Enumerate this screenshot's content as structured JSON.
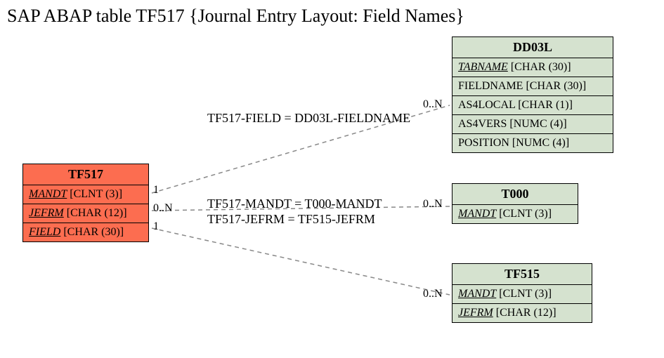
{
  "title": "SAP ABAP table TF517 {Journal Entry Layout:  Field Names}",
  "entities": {
    "tf517": {
      "name": "TF517",
      "rows": [
        {
          "field": "MANDT",
          "type": "[CLNT (3)]",
          "key": true
        },
        {
          "field": "JEFRM",
          "type": "[CHAR (12)]",
          "key": true
        },
        {
          "field": "FIELD",
          "type": "[CHAR (30)]",
          "key": true
        }
      ]
    },
    "dd03l": {
      "name": "DD03L",
      "rows": [
        {
          "field": "TABNAME",
          "type": "[CHAR (30)]",
          "key": true
        },
        {
          "field": "FIELDNAME",
          "type": "[CHAR (30)]",
          "key": false
        },
        {
          "field": "AS4LOCAL",
          "type": "[CHAR (1)]",
          "key": false
        },
        {
          "field": "AS4VERS",
          "type": "[NUMC (4)]",
          "key": false
        },
        {
          "field": "POSITION",
          "type": "[NUMC (4)]",
          "key": false
        }
      ]
    },
    "t000": {
      "name": "T000",
      "rows": [
        {
          "field": "MANDT",
          "type": "[CLNT (3)]",
          "key": true
        }
      ]
    },
    "tf515": {
      "name": "TF515",
      "rows": [
        {
          "field": "MANDT",
          "type": "[CLNT (3)]",
          "key": true
        },
        {
          "field": "JEFRM",
          "type": "[CHAR (12)]",
          "key": true
        }
      ]
    }
  },
  "relations": {
    "r1": "TF517-FIELD = DD03L-FIELDNAME",
    "r2": "TF517-MANDT = T000-MANDT",
    "r3": "TF517-JEFRM = TF515-JEFRM"
  },
  "card": {
    "tf517_top": "1",
    "tf517_mid": "0..N",
    "tf517_bot": "1",
    "dd03l": "0..N",
    "t000": "0..N",
    "tf515": "0..N"
  }
}
